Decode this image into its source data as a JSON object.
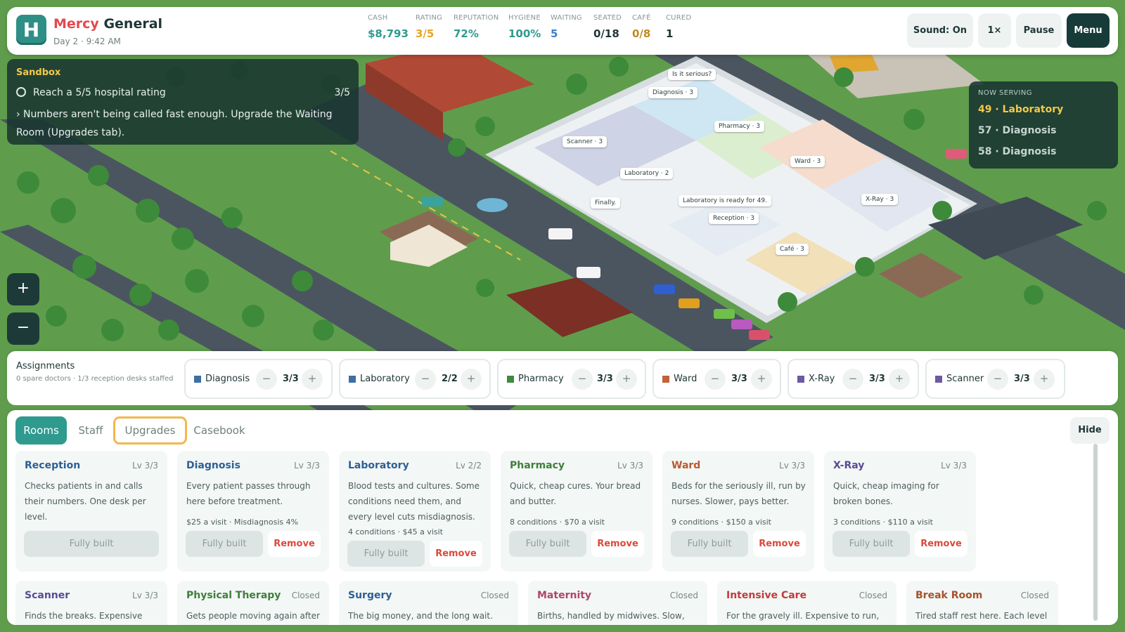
{
  "hud": {
    "hospital_name_accent": "Mercy",
    "hospital_name_rest": "General",
    "logo_letter": "H",
    "time": "Day 2 · 9:42 AM",
    "stats": [
      {
        "label": "CASH",
        "value": "$8,793",
        "color": "#2f9a8e"
      },
      {
        "label": "RATING",
        "value": "3/5",
        "color": "#e7a521"
      },
      {
        "label": "REPUTATION",
        "value": "72%",
        "color": "#2f9a8e"
      },
      {
        "label": "HYGIENE",
        "value": "100%",
        "color": "#2f9a8e"
      },
      {
        "label": "WAITING",
        "value": "5",
        "color": "#3d7fc9"
      },
      {
        "label": "SEATED",
        "value": "0/18",
        "color": "#1e3535"
      },
      {
        "label": "CAFÉ",
        "value": "0/8",
        "color": "#c08a1f"
      },
      {
        "label": "CURED",
        "value": "1",
        "color": "#1e3535"
      }
    ],
    "buttons": {
      "sound": "Sound: On",
      "speed": "1×",
      "pause": "Pause",
      "menu": "Menu"
    }
  },
  "objectives": {
    "title": "Sandbox",
    "goal": "Reach a 5/5 hospital rating",
    "progress": "3/5",
    "hint": "› Numbers aren't being called fast enough. Upgrade the Waiting Room (Upgrades tab)."
  },
  "now_serving": {
    "header": "NOW SERVING",
    "items": [
      "49 · Laboratory",
      "57 · Diagnosis",
      "58 · Diagnosis"
    ]
  },
  "map_labels": {
    "bubble_serious": "Is it serious?",
    "diagnosis": "Diagnosis · 3",
    "pharmacy": "Pharmacy · 3",
    "scanner": "Scanner · 3",
    "laboratory": "Laboratory · 2",
    "ward": "Ward · 3",
    "xray": "X-Ray · 3",
    "bubble_ready": "Laboratory is ready for 49.",
    "bubble_finally": "Finally.",
    "reception": "Reception · 3",
    "cafe": "Café · 3"
  },
  "zoom": {
    "in": "+",
    "out": "−"
  },
  "assignments": {
    "title": "Assignments",
    "subtitle": "0 spare doctors · 1/3 reception desks staffed",
    "rooms": [
      {
        "name": "Diagnosis",
        "count": "3/3",
        "color": "#3d6fa3"
      },
      {
        "name": "Laboratory",
        "count": "2/2",
        "color": "#3d6fa3"
      },
      {
        "name": "Pharmacy",
        "count": "3/3",
        "color": "#3f8a3f"
      },
      {
        "name": "Ward",
        "count": "3/3",
        "color": "#c2613a"
      },
      {
        "name": "X-Ray",
        "count": "3/3",
        "color": "#6c5aa3"
      },
      {
        "name": "Scanner",
        "count": "3/3",
        "color": "#6c5aa3"
      }
    ],
    "minus": "−",
    "plus": "+"
  },
  "tabs": [
    "Rooms",
    "Staff",
    "Upgrades",
    "Casebook"
  ],
  "hide_label": "Hide",
  "rooms": [
    {
      "name": "Reception",
      "level": "Lv 3/3",
      "color": "#2e5f93",
      "desc": "Checks patients in and calls their numbers. One desk per level.",
      "meta": "",
      "full": "Fully built",
      "remove": ""
    },
    {
      "name": "Diagnosis",
      "level": "Lv 3/3",
      "color": "#2e5f93",
      "desc": "Every patient passes through here before treatment.",
      "meta": "$25 a visit · Misdiagnosis 4%",
      "full": "Fully built",
      "remove": "Remove"
    },
    {
      "name": "Laboratory",
      "level": "Lv 2/2",
      "color": "#2e5f93",
      "desc": "Blood tests and cultures. Some conditions need them, and every level cuts misdiagnosis.",
      "meta": "4 conditions · $45 a visit",
      "full": "Fully built",
      "remove": "Remove"
    },
    {
      "name": "Pharmacy",
      "level": "Lv 3/3",
      "color": "#3f7f3a",
      "desc": "Quick, cheap cures. Your bread and butter.",
      "meta": "8 conditions · $70 a visit",
      "full": "Fully built",
      "remove": "Remove"
    },
    {
      "name": "Ward",
      "level": "Lv 3/3",
      "color": "#b85a30",
      "desc": "Beds for the seriously ill, run by nurses. Slower, pays better.",
      "meta": "9 conditions · $150 a visit",
      "full": "Fully built",
      "remove": "Remove"
    },
    {
      "name": "X-Ray",
      "level": "Lv 3/3",
      "color": "#5a4a96",
      "desc": "Quick, cheap imaging for broken bones.",
      "meta": "3 conditions · $110 a visit",
      "full": "Fully built",
      "remove": "Remove"
    }
  ],
  "rooms_row2": [
    {
      "name": "Scanner",
      "level": "Lv 3/3",
      "color": "#5a4a96",
      "desc": "Finds the breaks. Expensive"
    },
    {
      "name": "Physical Therapy",
      "level": "Closed",
      "color": "#3f7f3a",
      "desc": "Gets people moving again after"
    },
    {
      "name": "Surgery",
      "level": "Closed",
      "color": "#2e5f93",
      "desc": "The big money, and the long wait. Staff"
    },
    {
      "name": "Maternity",
      "level": "Closed",
      "color": "#b0456b",
      "desc": "Births, handled by midwives. Slow, and"
    },
    {
      "name": "Intensive Care",
      "level": "Closed",
      "color": "#c23b3b",
      "desc": "For the gravely ill. Expensive to run, and"
    },
    {
      "name": "Break Room",
      "level": "Closed",
      "color": "#a5532a",
      "desc": "Tired staff rest here. Each level"
    }
  ]
}
